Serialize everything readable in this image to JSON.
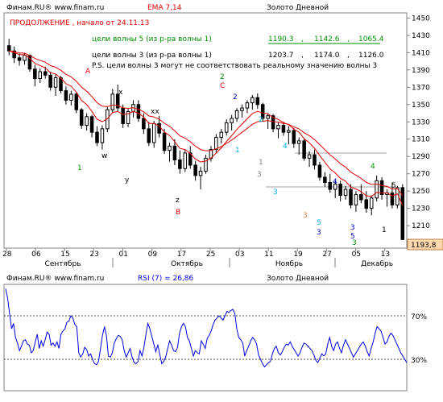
{
  "header": {
    "source": "Финам.RU® www.finam.ru",
    "indicator": "EMA 7,14",
    "title": "Золото Дневной"
  },
  "annotation": {
    "headline": "ПРОДОЛЖЕНИЕ , начало от 24.11.13",
    "wave5_label": "цели волны 5 (из р-ра волны 1)",
    "wave5_values": [
      "1190.3",
      ",",
      "1142.6",
      ",",
      "1065.4"
    ],
    "wave3_label": "цели волны 3 (из р-ра волны 1)",
    "wave3_values": [
      "1203.7",
      ",",
      "1174.0",
      ",",
      "1126.0"
    ],
    "note": "P.S. цели волны 3 могут не соответствовать реальному значению волны 3"
  },
  "price_axis": {
    "ticks": [
      "1450",
      "1430",
      "1410",
      "1390",
      "1370",
      "1350",
      "1330",
      "1310",
      "1290",
      "1270",
      "1250",
      "1230",
      "1210"
    ],
    "last_price": "1193,8"
  },
  "date_axis": {
    "days": [
      "28",
      "06",
      "15",
      "23",
      "01",
      "09",
      "17",
      "25",
      "03",
      "11",
      "19",
      "27",
      "05",
      "13"
    ],
    "months": [
      "Сентябрь",
      "Октябрь",
      "Ноябрь",
      "Декабрь"
    ]
  },
  "wave_labels": [
    "A",
    "1",
    "w",
    "x",
    "y",
    "xx",
    "z",
    "B",
    "2",
    "C",
    "2",
    "1",
    "3",
    "4",
    "3",
    "3",
    "5",
    "4",
    "3",
    "5",
    "4",
    "3",
    "5",
    "1",
    "2",
    "1",
    "3"
  ],
  "rsi_panel": {
    "source": "Финам.RU® www.finam.ru",
    "indicator": "RSI (7) = 26,86",
    "title": "Золото Дневной",
    "levels": [
      "70%",
      "30%"
    ]
  },
  "colors": {
    "ema_fast": "#e00000",
    "ema_slow": "#e00000",
    "rsi_line": "#0000e0",
    "wave5_text": "#009000",
    "headline_text": "#e00000",
    "last_price_bg": "#ffd8b0"
  },
  "chart_data": [
    {
      "type": "candlestick",
      "title": "Золото Дневной",
      "ylim": [
        1185,
        1455
      ],
      "x": [
        "28",
        "06",
        "15",
        "23",
        "01",
        "09",
        "17",
        "25",
        "03",
        "11",
        "19",
        "27",
        "05",
        "13"
      ],
      "candles": [
        [
          1418,
          1426,
          1407,
          1412
        ],
        [
          1412,
          1417,
          1398,
          1404
        ],
        [
          1404,
          1409,
          1395,
          1401
        ],
        [
          1401,
          1410,
          1396,
          1407
        ],
        [
          1407,
          1408,
          1388,
          1391
        ],
        [
          1391,
          1396,
          1371,
          1380
        ],
        [
          1380,
          1392,
          1375,
          1388
        ],
        [
          1388,
          1394,
          1380,
          1384
        ],
        [
          1384,
          1388,
          1366,
          1370
        ],
        [
          1370,
          1385,
          1360,
          1381
        ],
        [
          1381,
          1383,
          1363,
          1366
        ],
        [
          1366,
          1371,
          1350,
          1355
        ],
        [
          1355,
          1366,
          1349,
          1362
        ],
        [
          1362,
          1364,
          1340,
          1344
        ],
        [
          1344,
          1346,
          1322,
          1326
        ],
        [
          1326,
          1340,
          1320,
          1336
        ],
        [
          1336,
          1338,
          1312,
          1318
        ],
        [
          1318,
          1325,
          1302,
          1306
        ],
        [
          1306,
          1326,
          1298,
          1322
        ],
        [
          1322,
          1347,
          1318,
          1344
        ],
        [
          1344,
          1368,
          1340,
          1362
        ],
        [
          1362,
          1373,
          1342,
          1346
        ],
        [
          1346,
          1350,
          1323,
          1328
        ],
        [
          1328,
          1345,
          1324,
          1342
        ],
        [
          1342,
          1355,
          1335,
          1350
        ],
        [
          1350,
          1355,
          1330,
          1334
        ],
        [
          1334,
          1340,
          1316,
          1322
        ],
        [
          1322,
          1330,
          1302,
          1306
        ],
        [
          1306,
          1331,
          1300,
          1328
        ],
        [
          1328,
          1337,
          1312,
          1317
        ],
        [
          1317,
          1322,
          1293,
          1297
        ],
        [
          1297,
          1306,
          1284,
          1302
        ],
        [
          1302,
          1310,
          1280,
          1286
        ],
        [
          1286,
          1297,
          1270,
          1276
        ],
        [
          1276,
          1298,
          1272,
          1294
        ],
        [
          1294,
          1302,
          1276,
          1280
        ],
        [
          1280,
          1285,
          1262,
          1268
        ],
        [
          1268,
          1278,
          1252,
          1273
        ],
        [
          1273,
          1292,
          1270,
          1288
        ],
        [
          1288,
          1302,
          1284,
          1298
        ],
        [
          1298,
          1316,
          1294,
          1312
        ],
        [
          1312,
          1322,
          1305,
          1318
        ],
        [
          1318,
          1333,
          1314,
          1329
        ],
        [
          1329,
          1338,
          1320,
          1334
        ],
        [
          1334,
          1346,
          1330,
          1343
        ],
        [
          1343,
          1350,
          1335,
          1346
        ],
        [
          1346,
          1355,
          1340,
          1352
        ],
        [
          1352,
          1361,
          1344,
          1358
        ],
        [
          1358,
          1363,
          1345,
          1350
        ],
        [
          1350,
          1352,
          1330,
          1334
        ],
        [
          1334,
          1340,
          1322,
          1337
        ],
        [
          1337,
          1339,
          1318,
          1322
        ],
        [
          1322,
          1329,
          1311,
          1326
        ],
        [
          1326,
          1330,
          1314,
          1318
        ],
        [
          1318,
          1325,
          1304,
          1320
        ],
        [
          1320,
          1323,
          1300,
          1305
        ],
        [
          1305,
          1312,
          1292,
          1308
        ],
        [
          1308,
          1310,
          1285,
          1288
        ],
        [
          1288,
          1296,
          1278,
          1292
        ],
        [
          1292,
          1298,
          1275,
          1280
        ],
        [
          1280,
          1284,
          1262,
          1266
        ],
        [
          1266,
          1272,
          1255,
          1260
        ],
        [
          1260,
          1270,
          1248,
          1252
        ],
        [
          1252,
          1262,
          1242,
          1258
        ],
        [
          1258,
          1262,
          1238,
          1245
        ],
        [
          1245,
          1256,
          1240,
          1252
        ],
        [
          1252,
          1258,
          1230,
          1234
        ],
        [
          1234,
          1250,
          1226,
          1246
        ],
        [
          1246,
          1258,
          1236,
          1240
        ],
        [
          1240,
          1250,
          1225,
          1230
        ],
        [
          1230,
          1245,
          1222,
          1242
        ],
        [
          1242,
          1268,
          1238,
          1262
        ],
        [
          1262,
          1266,
          1240,
          1246
        ],
        [
          1246,
          1252,
          1232,
          1248
        ],
        [
          1248,
          1260,
          1230,
          1234
        ],
        [
          1234,
          1256,
          1230,
          1254
        ],
        [
          1254,
          1258,
          1212,
          1194
        ]
      ]
    },
    {
      "type": "line",
      "title": "RSI (7) = 26,86",
      "ylim": [
        0,
        100
      ],
      "levels": [
        70,
        30
      ],
      "values": [
        95,
        86,
        72,
        58,
        63,
        50,
        45,
        38,
        42,
        47,
        48,
        44,
        43,
        36,
        38,
        46,
        53,
        40,
        47,
        42,
        48,
        55,
        53,
        43,
        45,
        42,
        46,
        40,
        53,
        56,
        58,
        64,
        65,
        70,
        68,
        62,
        60,
        36,
        32,
        35,
        41,
        39,
        33,
        35,
        30,
        26,
        25,
        28,
        40,
        52,
        60,
        52,
        33,
        32,
        36,
        45,
        49,
        52,
        51,
        48,
        38,
        32,
        36,
        40,
        32,
        27,
        26,
        28,
        38,
        33,
        41,
        53,
        63,
        58,
        51,
        44,
        37,
        43,
        35,
        26,
        28,
        32,
        40,
        47,
        43,
        38,
        37,
        41,
        54,
        60,
        63,
        60,
        50,
        47,
        40,
        33,
        38,
        36,
        35,
        47,
        44,
        40,
        49,
        52,
        56,
        62,
        66,
        68,
        70,
        68,
        66,
        70,
        74,
        73,
        75,
        76,
        72,
        58,
        50,
        48,
        45,
        33,
        38,
        42,
        47,
        50,
        48,
        44,
        34,
        30,
        26,
        23,
        25,
        27,
        28,
        35,
        40,
        42,
        36,
        34,
        37,
        41,
        44,
        43,
        46,
        42,
        39,
        36,
        33,
        36,
        41,
        45,
        44,
        42,
        40,
        38,
        34,
        29,
        27,
        31,
        35,
        33,
        35,
        44,
        50,
        42,
        38,
        44,
        46,
        40,
        36,
        43,
        48,
        44,
        40,
        36,
        32,
        35,
        38,
        41,
        44,
        46,
        42,
        37,
        33,
        40,
        46,
        54,
        60,
        58,
        56,
        50,
        44,
        46,
        51,
        54,
        52,
        48,
        44,
        40,
        36,
        33,
        30,
        27
      ]
    }
  ]
}
